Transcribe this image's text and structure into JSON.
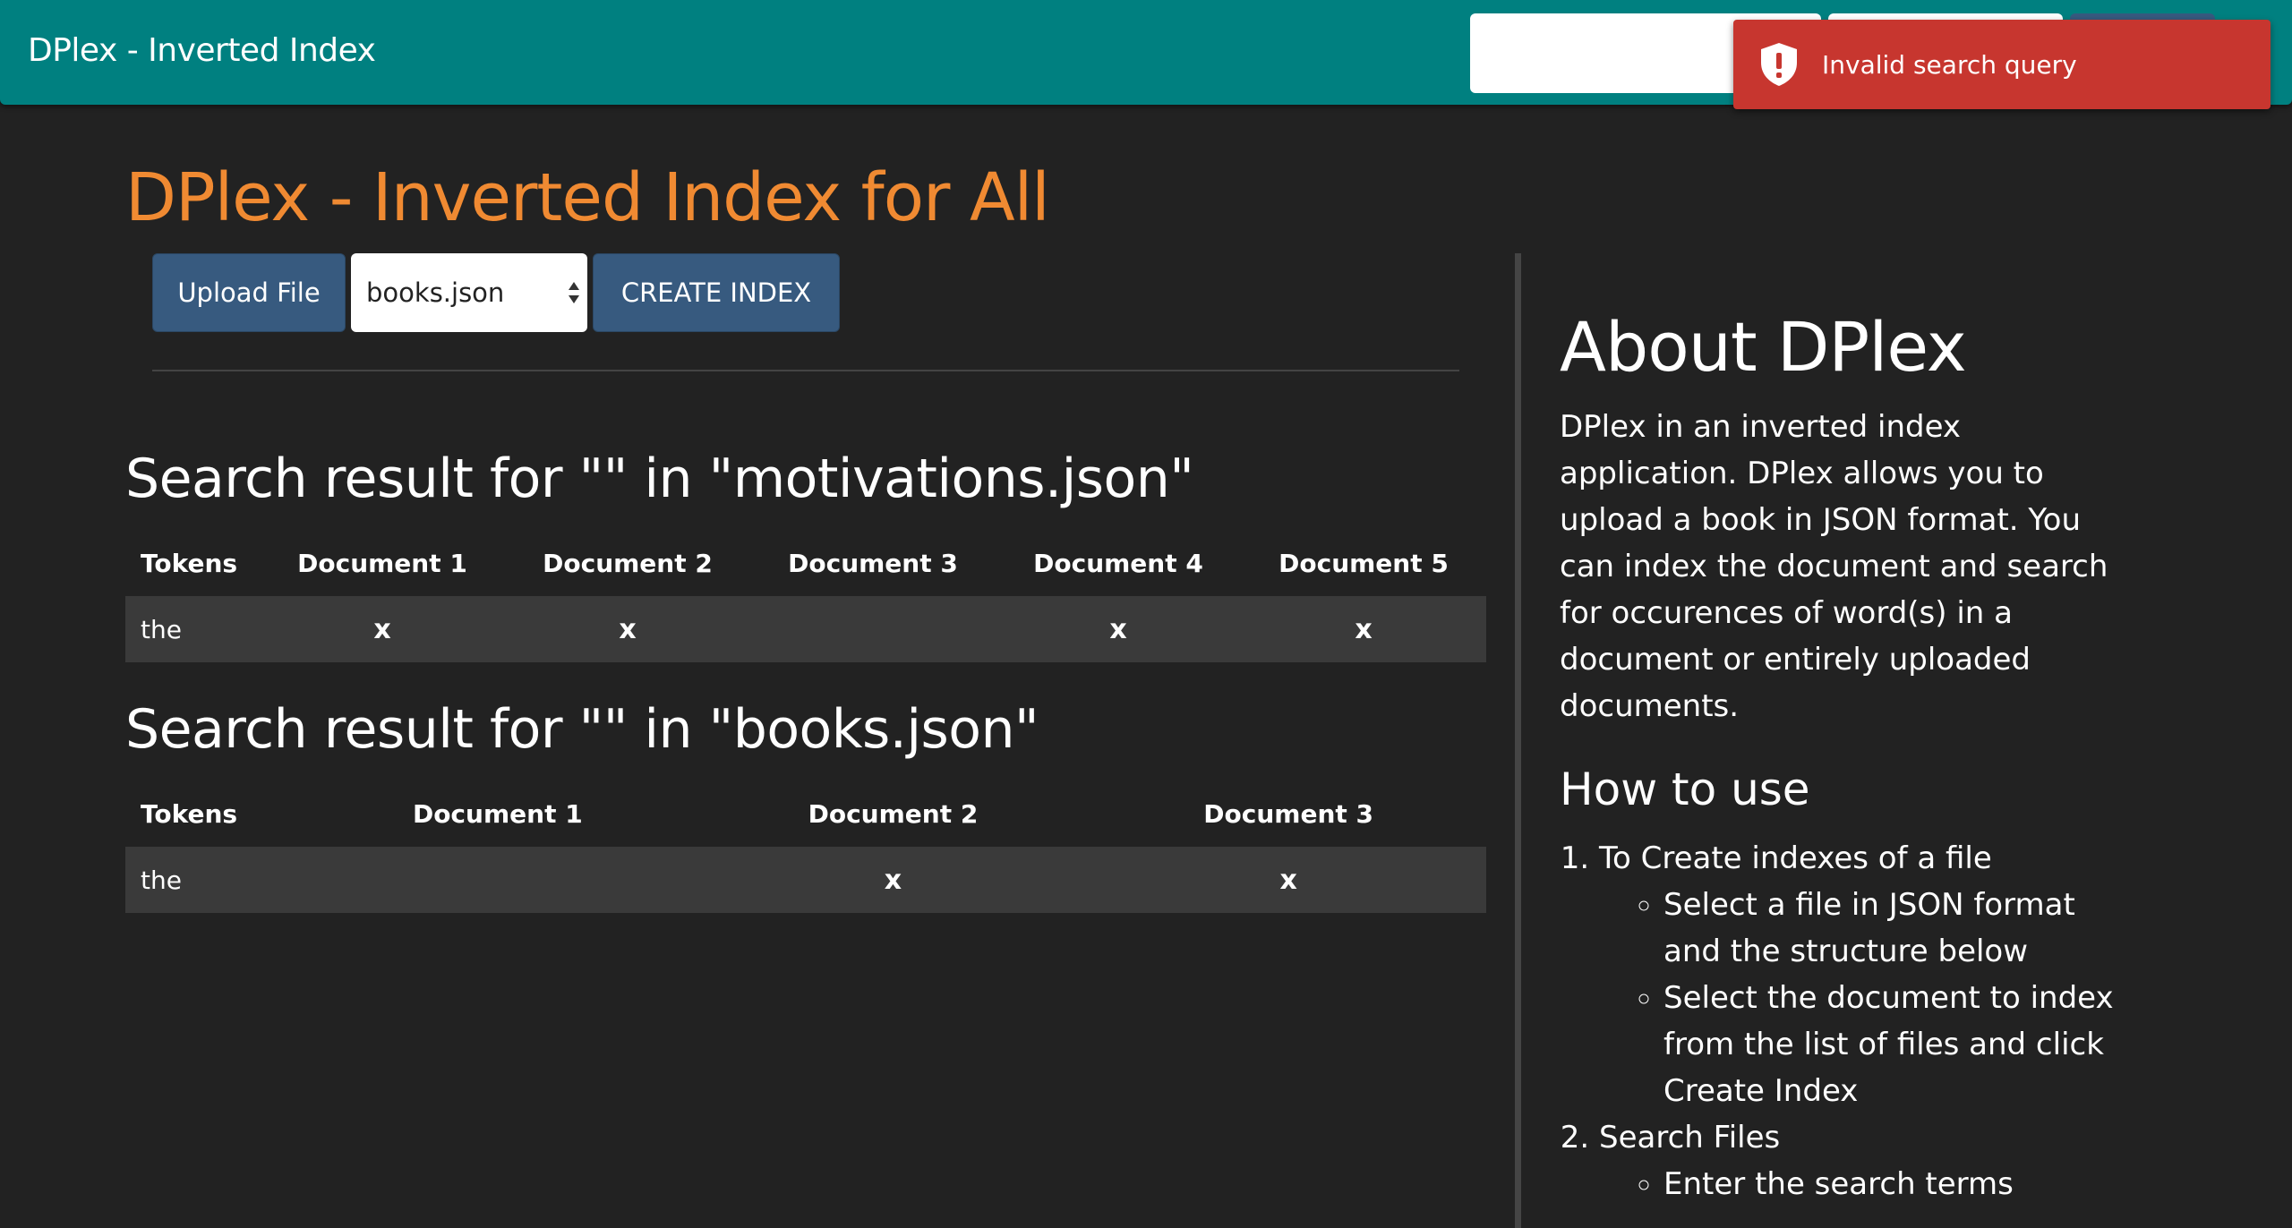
{
  "navbar": {
    "brand": "DPlex - Inverted Index",
    "background": "#008080"
  },
  "toast": {
    "message": "Invalid search query",
    "icon": "shield-alert-icon",
    "color": "#c7362f"
  },
  "page": {
    "title": "DPlex - Inverted Index for All",
    "title_color": "#f08a32"
  },
  "controls": {
    "upload_label": "Upload File",
    "selected_file": "books.json",
    "create_label": "CREATE INDEX"
  },
  "results": [
    {
      "title": "Search result for \"\" in \"motivations.json\"",
      "headers": [
        "Tokens",
        "Document 1",
        "Document 2",
        "Document 3",
        "Document 4",
        "Document 5"
      ],
      "rows": [
        [
          "the",
          "x",
          "x",
          "",
          "x",
          "x"
        ]
      ]
    },
    {
      "title": "Search result for \"\" in \"books.json\"",
      "headers": [
        "Tokens",
        "Document 1",
        "Document 2",
        "Document 3"
      ],
      "rows": [
        [
          "the",
          "",
          "x",
          "x"
        ]
      ]
    }
  ],
  "about": {
    "title": "About DPlex",
    "body": "DPlex in an inverted index application. DPlex allows you to upload a book in JSON format. You can index the document and search for occurences of word(s) in a document or entirely uploaded documents.",
    "howto_title": "How to use",
    "steps": [
      {
        "label": "To Create indexes of a file",
        "subs": [
          "Select a file in JSON format and the structure below",
          "Select the document to index from the list of files and click Create Index"
        ]
      },
      {
        "label": "Search Files",
        "subs": [
          "Enter the search terms"
        ]
      }
    ]
  }
}
